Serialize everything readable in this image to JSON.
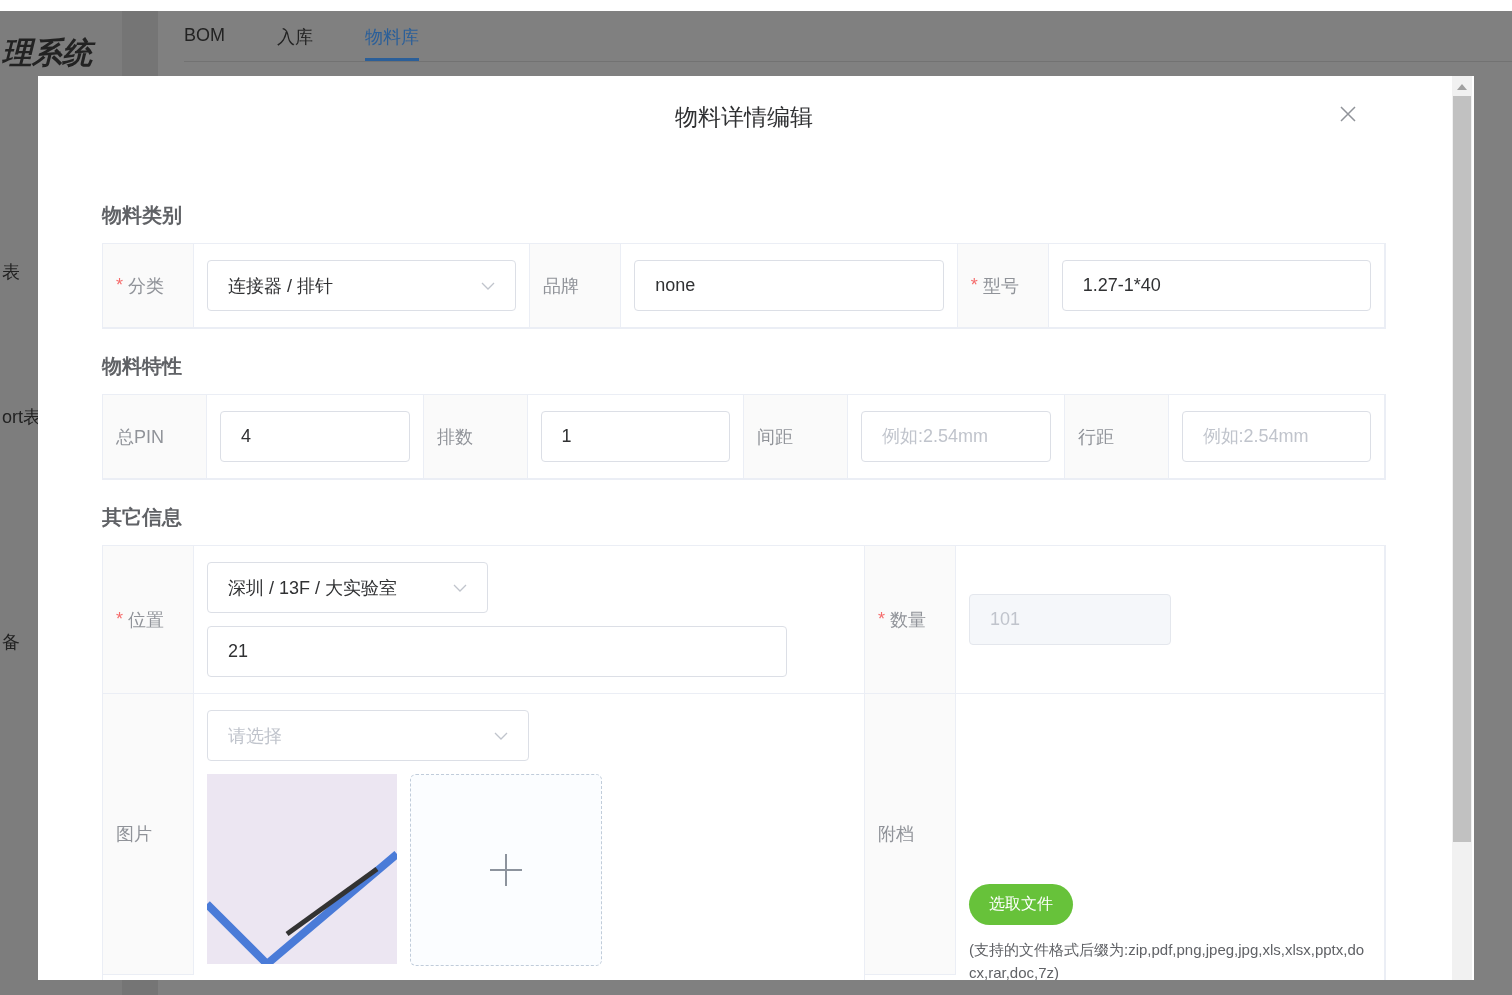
{
  "background": {
    "app_title": "理系统",
    "tabs": [
      {
        "label": "BOM",
        "selected": false
      },
      {
        "label": "入库",
        "selected": false
      },
      {
        "label": "物料库",
        "selected": true
      }
    ],
    "sidebar_items": [
      "表",
      "ort表",
      "备"
    ]
  },
  "dialog": {
    "title": "物料详情编辑",
    "required_mark": "*",
    "sections": [
      {
        "title": "物料类别",
        "fields": [
          {
            "label": "分类",
            "required": true,
            "kind": "select",
            "value": "连接器 / 排针"
          },
          {
            "label": "品牌",
            "required": false,
            "kind": "input",
            "value": "none"
          },
          {
            "label": "型号",
            "required": true,
            "kind": "input",
            "value": "1.27-1*40"
          }
        ]
      },
      {
        "title": "物料特性",
        "fields": [
          {
            "label": "总PIN",
            "required": false,
            "kind": "input",
            "value": "4"
          },
          {
            "label": "排数",
            "required": false,
            "kind": "input",
            "value": "1"
          },
          {
            "label": "间距",
            "required": false,
            "kind": "input",
            "placeholder": "例如:2.54mm"
          },
          {
            "label": "行距",
            "required": false,
            "kind": "input",
            "placeholder": "例如:2.54mm"
          }
        ]
      }
    ],
    "other": {
      "title": "其它信息",
      "location": {
        "label": "位置",
        "required": true,
        "select_value": "深圳 / 13F / 大实验室",
        "detail_value": "21"
      },
      "quantity": {
        "label": "数量",
        "required": true,
        "value": "101",
        "disabled": true
      },
      "picture": {
        "label": "图片",
        "placeholder": "请选择"
      },
      "attachment": {
        "label": "附档",
        "button": "选取文件",
        "hint": "(支持的文件格式后缀为:zip,pdf,png,jpeg,jpg,xls,xlsx,pptx,docx,rar,doc,7z)"
      }
    }
  }
}
